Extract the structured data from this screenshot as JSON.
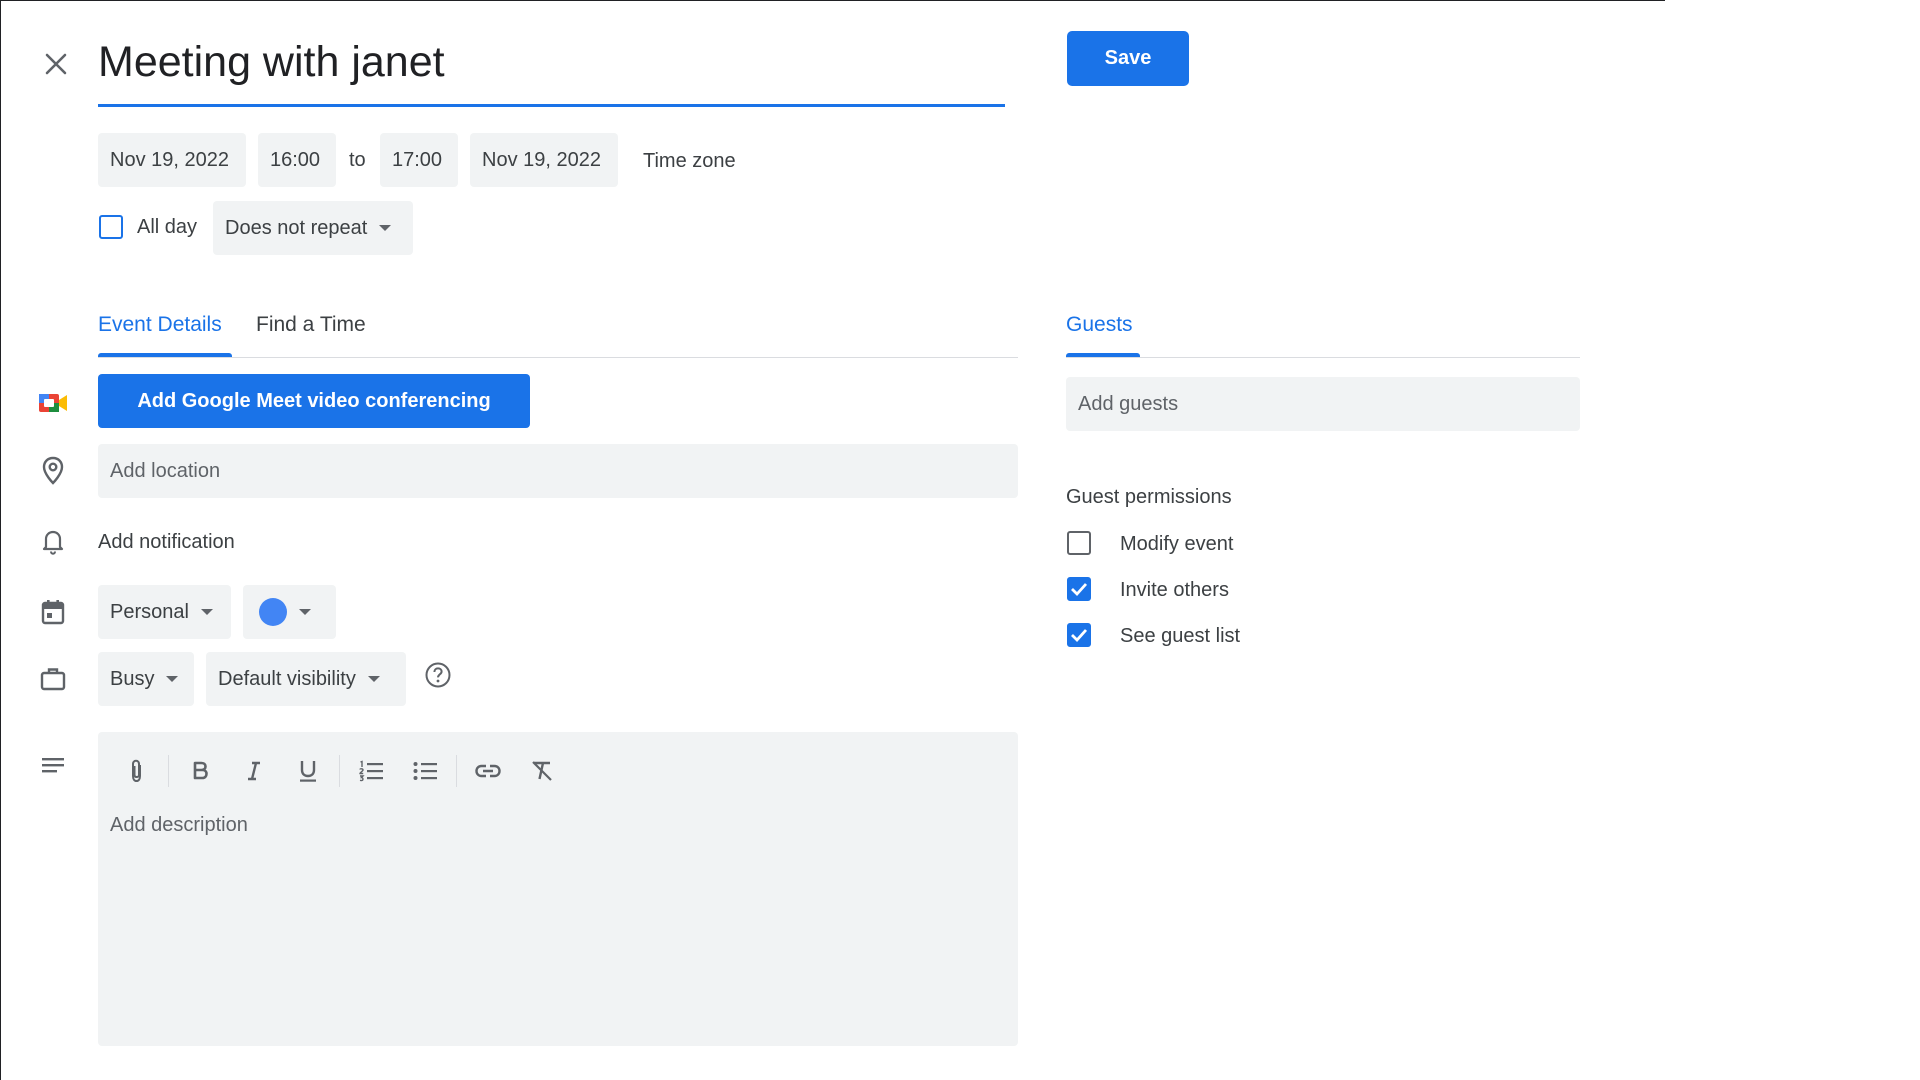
{
  "event": {
    "title": "Meeting with janet",
    "save_label": "Save"
  },
  "datetime": {
    "start_date": "Nov 19, 2022",
    "start_time": "16:00",
    "to_label": "to",
    "end_time": "17:00",
    "end_date": "Nov 19, 2022",
    "timezone_label": "Time zone",
    "all_day_label": "All day",
    "all_day_checked": false,
    "repeat_value": "Does not repeat"
  },
  "tabs": {
    "event_details": "Event Details",
    "find_a_time": "Find a Time",
    "guests": "Guests"
  },
  "details": {
    "meet_button": "Add Google Meet video conferencing",
    "location_placeholder": "Add location",
    "notification_label": "Add notification",
    "calendar_value": "Personal",
    "event_color": "#4285f4",
    "availability_value": "Busy",
    "visibility_value": "Default visibility",
    "description_placeholder": "Add description"
  },
  "guests": {
    "add_placeholder": "Add guests",
    "permissions_title": "Guest permissions",
    "permissions": [
      {
        "label": "Modify event",
        "checked": false
      },
      {
        "label": "Invite others",
        "checked": true
      },
      {
        "label": "See guest list",
        "checked": true
      }
    ]
  },
  "colors": {
    "accent": "#1a73e8",
    "field_bg": "#f1f3f4"
  },
  "icons": {
    "close": "close-icon",
    "meet": "google-meet-icon",
    "location": "location-pin-icon",
    "notification": "bell-icon",
    "calendar": "calendar-icon",
    "availability": "briefcase-icon",
    "help": "help-circle-icon",
    "description": "notes-lines-icon",
    "toolbar": [
      "attachment-icon",
      "bold-icon",
      "italic-icon",
      "underline-icon",
      "numbered-list-icon",
      "bulleted-list-icon",
      "link-icon",
      "clear-formatting-icon"
    ]
  }
}
